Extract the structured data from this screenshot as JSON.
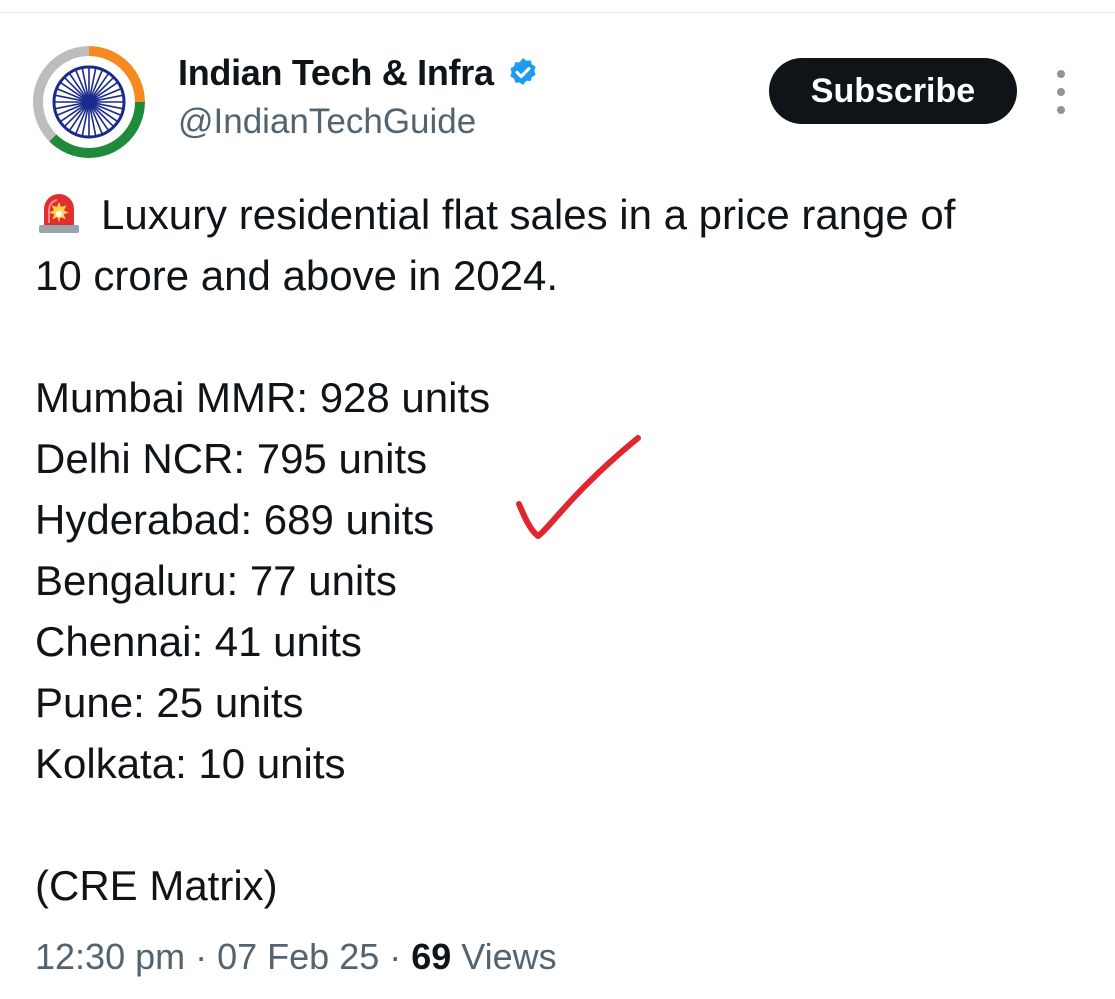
{
  "author": {
    "display_name": "Indian Tech & Infra",
    "handle": "@IndianTechGuide",
    "verified": true,
    "avatar_icon": "ashoka-chakra-tricolor-avatar"
  },
  "actions": {
    "subscribe_label": "Subscribe",
    "more_icon": "vertical-ellipsis-icon"
  },
  "tweet": {
    "emoji": "police-siren-emoji",
    "intro_line1": "Luxury residential flat sales in a price range of",
    "intro_line2": "10 crore and above in 2024.",
    "sales": [
      {
        "text": "Mumbai MMR: 928 units"
      },
      {
        "text": "Delhi NCR: 795 units"
      },
      {
        "text": "Hyderabad: 689 units"
      },
      {
        "text": "Bengaluru: 77 units"
      },
      {
        "text": "Chennai: 41 units"
      },
      {
        "text": "Pune: 25 units"
      },
      {
        "text": "Kolkata: 10 units"
      }
    ],
    "source": "(CRE Matrix)"
  },
  "meta": {
    "time": "12:30 pm",
    "separator": " · ",
    "date": "07 Feb 25",
    "views_count": "69",
    "views_label": " Views"
  },
  "colors": {
    "accent": "#0f1419",
    "secondary_text": "#536471",
    "verified_blue": "#1d9bf0",
    "annotation_red": "#e0262f"
  }
}
